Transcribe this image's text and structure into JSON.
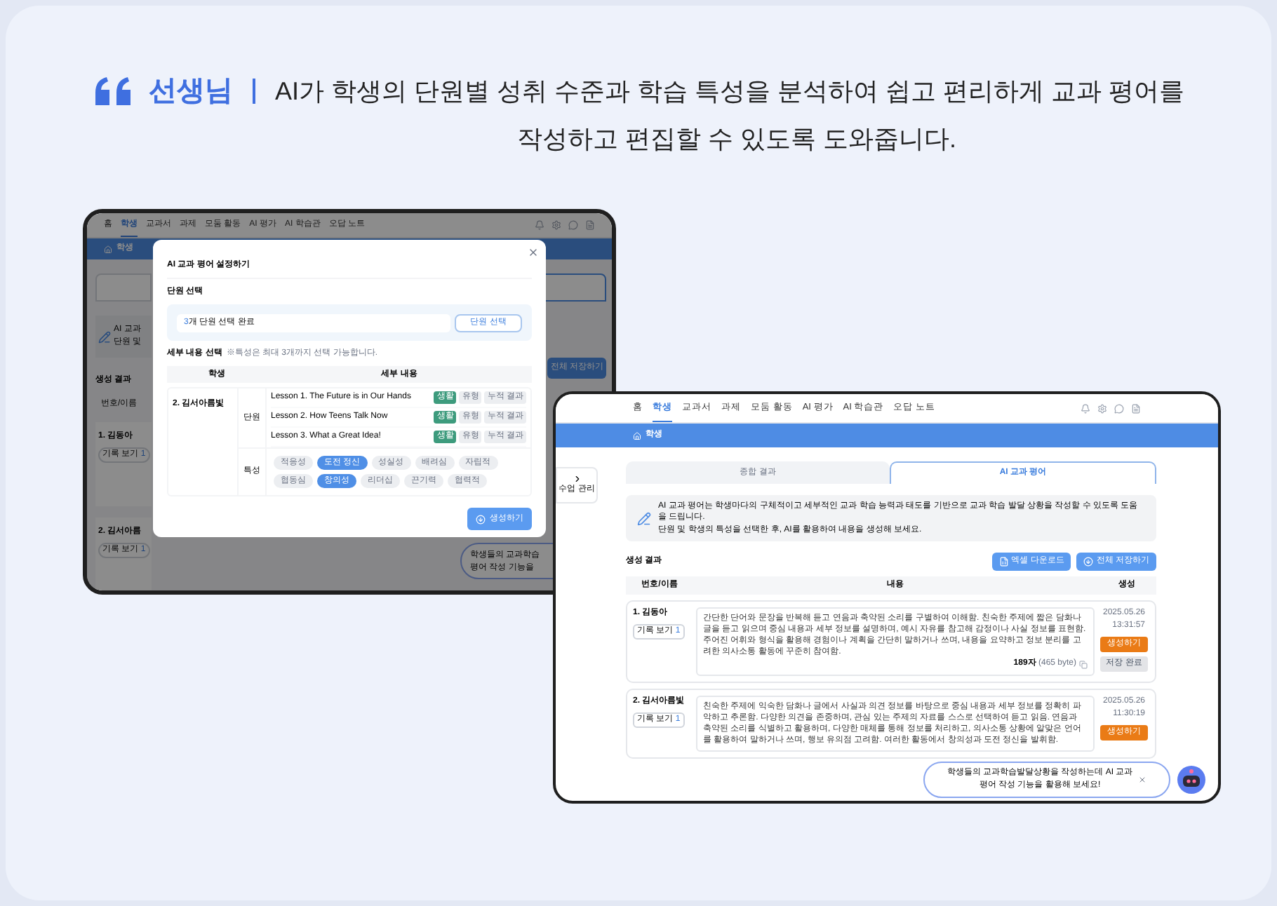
{
  "headline": {
    "speaker": "선생님",
    "lines": [
      "AI가 학생의 단원별 성취 수준과 학습 특성을 분석하여 쉽고 편리하게 교과 평어를",
      "작성하고 편집할 수 있도록 도와줍니다."
    ]
  },
  "back_screen": {
    "nav": [
      {
        "label": "홈",
        "selected": false
      },
      {
        "label": "학생",
        "selected": true
      },
      {
        "label": "교과서",
        "selected": false
      },
      {
        "label": "과제",
        "selected": false
      },
      {
        "label": "모둠 활동",
        "selected": false
      },
      {
        "label": "AI 평가",
        "selected": false
      },
      {
        "label": "AI 학습관",
        "selected": false
      },
      {
        "label": "오답 노트",
        "selected": false
      }
    ],
    "breadcrumb": "학생",
    "page_peek": {
      "info_lines": [
        "AI 교과",
        "단원 및"
      ],
      "results_title": "생성 결과",
      "save_all": "전체 저장하기",
      "column": "번호/이름",
      "students": [
        {
          "name": "1. 김동아",
          "records": "기록 보기",
          "count": "1"
        },
        {
          "name": "2. 김서아름",
          "records": "기록 보기",
          "count": "1"
        }
      ],
      "chat_lines": [
        "학생들의 교과학습",
        "평어 작성 기능을"
      ]
    },
    "modal": {
      "title": "AI 교과 평어 설정하기",
      "unit_section": "단원 선택",
      "unit_field": {
        "count": "3",
        "value": "개 단원 선택 완료"
      },
      "unit_button": "단원 선택",
      "detail_section": "세부 내용 선택",
      "detail_note": "※특성은 최대 3개까지 선택 가능합니다.",
      "columns": [
        "학생",
        "세부 내용"
      ],
      "student": "2. 김서아름빛",
      "unit_label": "단원",
      "lessons": [
        {
          "title": "Lesson 1. The Future is in Our Hands",
          "options": [
            {
              "label": "생활",
              "selected": true
            },
            {
              "label": "유형",
              "selected": false
            },
            {
              "label": "누적 결과",
              "selected": false
            }
          ]
        },
        {
          "title": "Lesson 2. How Teens Talk Now",
          "options": [
            {
              "label": "생활",
              "selected": true
            },
            {
              "label": "유형",
              "selected": false
            },
            {
              "label": "누적 결과",
              "selected": false
            }
          ]
        },
        {
          "title": "Lesson 3. What a Great Idea!",
          "options": [
            {
              "label": "생활",
              "selected": true
            },
            {
              "label": "유형",
              "selected": false
            },
            {
              "label": "누적 결과",
              "selected": false
            }
          ]
        }
      ],
      "trait_label": "특성",
      "traits": [
        {
          "label": "적응성",
          "selected": false
        },
        {
          "label": "도전 정신",
          "selected": true
        },
        {
          "label": "성실성",
          "selected": false
        },
        {
          "label": "배려심",
          "selected": false
        },
        {
          "label": "자립적",
          "selected": false
        },
        {
          "label": "협동심",
          "selected": false
        },
        {
          "label": "창의성",
          "selected": true
        },
        {
          "label": "리더십",
          "selected": false
        },
        {
          "label": "끈기력",
          "selected": false
        },
        {
          "label": "협력적",
          "selected": false
        }
      ],
      "generate": "생성하기"
    }
  },
  "front_screen": {
    "nav": [
      {
        "label": "홈",
        "selected": false
      },
      {
        "label": "학생",
        "selected": true
      },
      {
        "label": "교과서",
        "selected": false
      },
      {
        "label": "과제",
        "selected": false
      },
      {
        "label": "모둠 활동",
        "selected": false
      },
      {
        "label": "AI 평가",
        "selected": false
      },
      {
        "label": "AI 학습관",
        "selected": false
      },
      {
        "label": "오답 노트",
        "selected": false
      }
    ],
    "breadcrumb": "학생",
    "side_button": "수업 관리",
    "tabs": [
      {
        "label": "종합 결과",
        "selected": false
      },
      {
        "label": "AI 교과 평어",
        "selected": true
      }
    ],
    "info_lines": [
      "AI 교과 평어는 학생마다의 구체적이고 세부적인 교과 학습 능력과 태도를 기반으로 교과 학습 발달 상황을 작성할 수 있도록 도움을 드립니다.",
      "단원 및 학생의 특성을 선택한 후, AI를 활용하여 내용을 생성해 보세요."
    ],
    "results_title": "생성 결과",
    "excel_button": "엑셀 다운로드",
    "save_all_button": "전체 저장하기",
    "columns": [
      "번호/이름",
      "내용",
      "생성"
    ],
    "rows": [
      {
        "name": "1. 김동아",
        "records": "기록 보기",
        "count": "1",
        "content": "간단한 단어와 문장을 반복해 듣고 연음과 축약된 소리를 구별하여 이해함. 친숙한 주제에 짧은 담화나 글을 듣고 읽으며 중심 내용과 세부 정보를 설명하며, 예시 자유를 참고해 감정이나 사실 정보를 표현함. 주어진 어휘와 형식을 활용해 경험이나 계획을 간단히 말하거나 쓰며, 내용을 요약하고 정보 분리를 고려한 의사소통 활동에 꾸준히 참여함.",
        "length": "189자",
        "bytes": "(465 byte)",
        "date": "2025.05.26",
        "time": "13:31:57",
        "generate": "생성하기",
        "save": "저장 완료",
        "saved": true
      },
      {
        "name": "2. 김서아름빛",
        "records": "기록 보기",
        "count": "1",
        "content": "친숙한 주제에 익숙한 담화나 글에서 사실과 의견 정보를 바탕으로 중심 내용과 세부 정보를 정확히 파악하고 추론함. 다양한 의견을 존중하며, 관심 있는 주제의 자료를 스스로 선택하여 듣고 읽음. 연음과 축약된 소리를 식별하고 활용하며, 다양한 매체를 통해 정보를 처리하고, 의사소통 상황에 알맞은 언어를 활용하여 말하거나 쓰며, 행보 유의점 고려함. 여러한 활동에서 창의성과 도전 정신을 발휘함.",
        "date": "2025.05.26",
        "time": "11:30:19",
        "generate": "생성하기",
        "saved": false
      }
    ],
    "chat_lines": [
      "학생들의 교과학습발달상황을 작성하는데 AI 교과",
      "평어 작성 기능을 활용해 보세요!"
    ]
  }
}
